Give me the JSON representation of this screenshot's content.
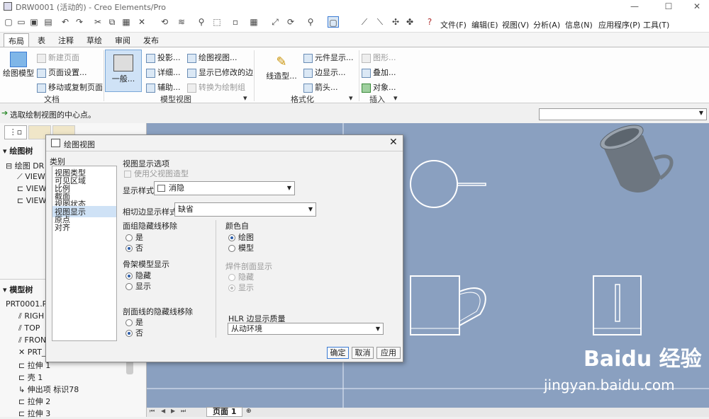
{
  "window": {
    "title": "DRW0001 (活动的) - Creo Elements/Pro"
  },
  "menu": [
    "文件(F)",
    "编辑(E)",
    "视图(V)",
    "分析(A)",
    "信息(N)",
    "应用程序(P)",
    "工具(T)"
  ],
  "ribbon_tabs": [
    "布局",
    "表",
    "注释",
    "草绘",
    "审阅",
    "发布"
  ],
  "ribbon": {
    "drawing_model": "绘图模型",
    "doc_group": {
      "new_page": "新建页面",
      "page_setup": "页面设置...",
      "move_copy": "移动或复制页面",
      "label": "文档"
    },
    "general": "一般...",
    "model_group": {
      "projection": "投影...",
      "detail": "详细...",
      "auxiliary": "辅助...",
      "drawing_view": "绘图视图...",
      "show_modified": "显示已修改的边",
      "convert": "转换为绘制组",
      "label": "模型视图"
    },
    "format_group": {
      "line_style": "线造型...",
      "component_display": "元件显示...",
      "edge_display": "边显示...",
      "arrow": "箭头...",
      "label": "格式化"
    },
    "insert_group": {
      "graphics": "图形...",
      "overlay": "叠加...",
      "object": "对象...",
      "label": "插入"
    }
  },
  "status_message": "选取绘制视图的中心点。",
  "left_panel": {
    "drawing_tree_title": "绘图树",
    "drawing_items": [
      "绘图 DR",
      "VIEW",
      "VIEW",
      "VIEW"
    ],
    "model_tree_title": "模型树",
    "model_items": [
      "PRT0001.PR",
      "RIGH",
      "TOP",
      "FRON",
      "PRT_",
      "拉伸 1",
      "壳 1",
      "伸出项 标识78",
      "拉伸 2",
      "拉伸 3"
    ]
  },
  "dialog": {
    "title": "绘图视图",
    "category_label": "类别",
    "categories": [
      "视图类型",
      "可见区域",
      "比例",
      "截面",
      "视图状态",
      "视图显示",
      "原点",
      "对齐"
    ],
    "selected_category": "视图显示",
    "section_title": "视图显示选项",
    "use_parent": "使用父视图造型",
    "display_style_label": "显示样式",
    "display_style_value": "消隐",
    "tangent_style_label": "相切边显示样式",
    "tangent_style_value": "缺省",
    "face_hidden_label": "面组隐藏线移除",
    "yes": "是",
    "no": "否",
    "color_from_label": "颜色自",
    "color_drawing": "绘图",
    "color_model": "模型",
    "skeleton_label": "骨架模型显示",
    "hidden": "隐藏",
    "show": "显示",
    "weld_label": "焊件剖面显示",
    "section_hidden_label": "剖面线的隐藏线移除",
    "hlr_label": "HLR 边显示质量",
    "hlr_value": "从动环境",
    "ok": "确定",
    "cancel": "取消",
    "apply": "应用"
  },
  "bottom": {
    "page_label": "页面 1"
  },
  "watermark": {
    "site": "Baidu 经验",
    "url": "jingyan.baidu.com"
  }
}
